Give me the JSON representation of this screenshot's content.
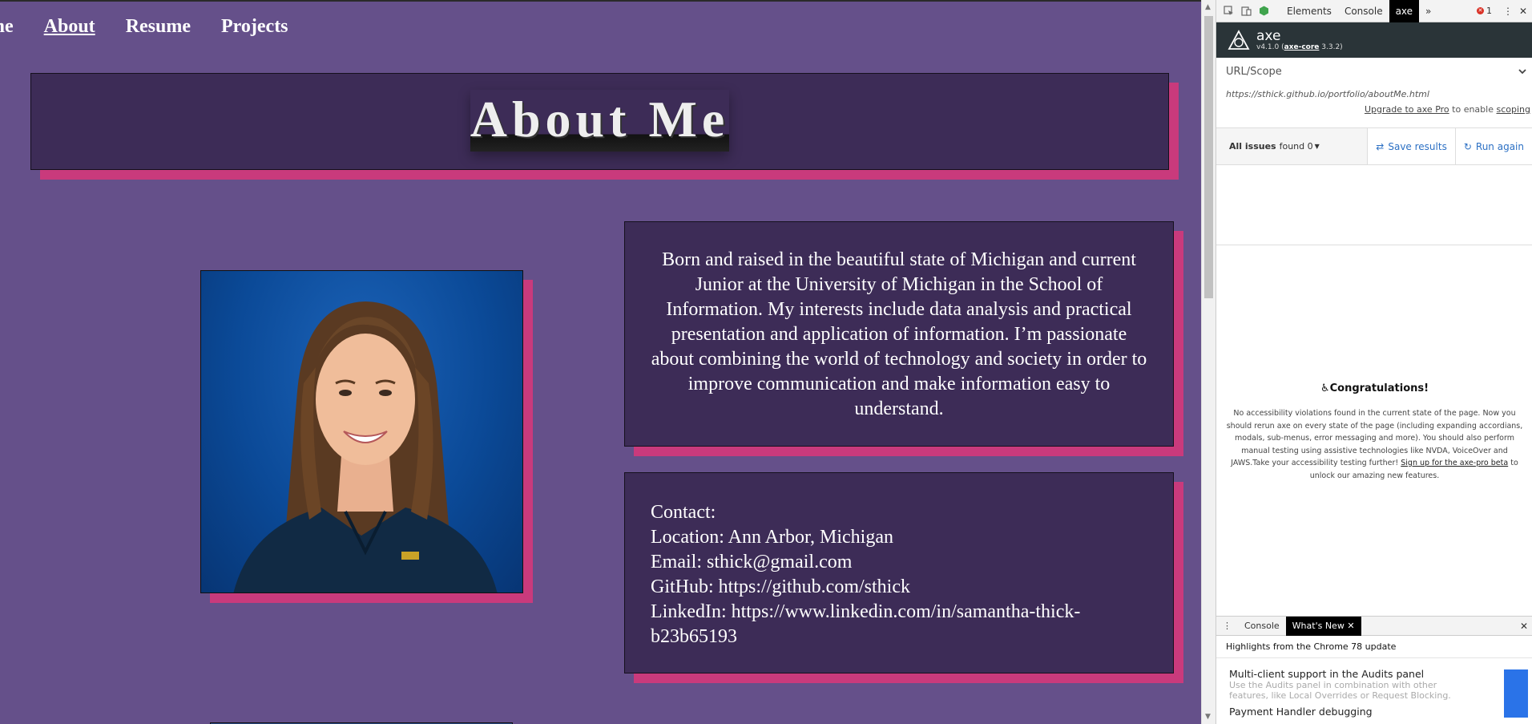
{
  "nav": {
    "items": [
      {
        "label": "Home",
        "visible_label": "ome",
        "active": false
      },
      {
        "label": "About",
        "active": true
      },
      {
        "label": "Resume",
        "active": false
      },
      {
        "label": "Projects",
        "active": false
      }
    ]
  },
  "page": {
    "title": "About Me",
    "bio": "Born and raised in the beautiful state of Michigan and current Junior at the University of Michigan in the School of Information. My interests include data analysis and practical presentation and application of information. I’m passionate about combining the world of technology and society in order to improve communication and make information easy to understand.",
    "contact": {
      "heading": "Contact:",
      "location": "Location: Ann Arbor, Michigan",
      "email": "Email: sthick@gmail.com",
      "github": "GitHub: https://github.com/sthick",
      "linkedin": "LinkedIn: https://www.linkedin.com/in/samantha-thick-b23b65193"
    },
    "colors": {
      "background": "#65508a",
      "box": "#3d2c57",
      "accent_shadow": "#c93a7c"
    }
  },
  "devtools": {
    "tabs": [
      "Elements",
      "Console",
      "axe"
    ],
    "active_tab": "axe",
    "more_tabs": "»",
    "error_count": "1",
    "axe": {
      "name": "axe",
      "version": "v4.1.0",
      "core_label": "axe-core",
      "core_version": "3.3.2",
      "scope_title": "URL/Scope",
      "url": "https://sthick.github.io/portfolio/aboutMe.html",
      "upgrade_link": "Upgrade to axe Pro",
      "upgrade_mid": "to enable",
      "upgrade_tail": "scoping",
      "issues_label": "All issues",
      "issues_found": "found 0",
      "save_results": "Save results",
      "run_again": "Run again",
      "congrats_title": "Congratulations!",
      "congrats_body": "No accessibility violations found in the current state of the page. Now you should rerun axe on every state of the page (including expanding accordians, modals, sub-menus, error messaging and more). You should also perform manual testing using assistive technologies like NVDA, VoiceOver and JAWS.Take your accessibility testing further!",
      "congrats_link": "Sign up for the axe-pro beta",
      "congrats_tail": "to unlock our amazing new features."
    },
    "drawer": {
      "tabs": [
        "Console",
        "What's New"
      ],
      "active_tab": "What's New",
      "heading": "Highlights from the Chrome 78 update",
      "features": [
        {
          "title": "Multi-client support in the Audits panel",
          "desc": "Use the Audits panel in combination with other features, like Local Overrides or Request Blocking."
        },
        {
          "title": "Payment Handler debugging",
          "desc": ""
        }
      ]
    }
  }
}
